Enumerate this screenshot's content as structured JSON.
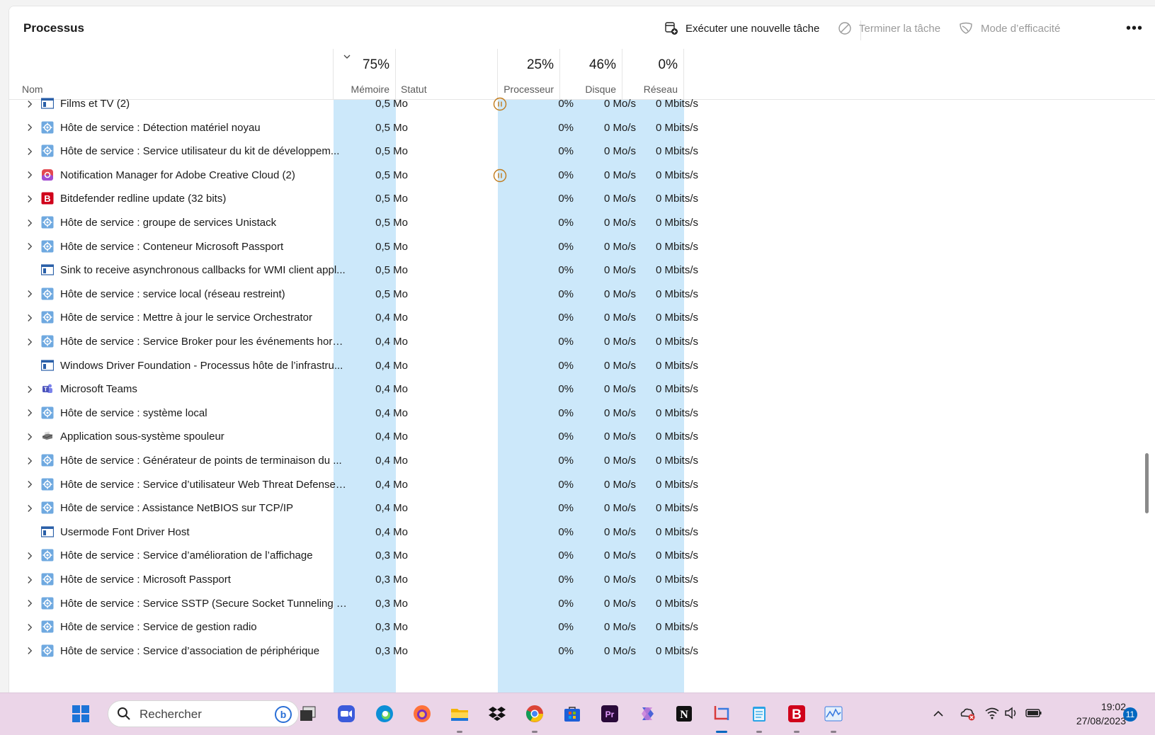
{
  "page": {
    "title": "Processus"
  },
  "toolbar": {
    "new_task": "Exécuter une nouvelle tâche",
    "end_task": "Terminer la tâche",
    "efficiency": "Mode d’efficacité",
    "more": "•••"
  },
  "columns": {
    "name": "Nom",
    "memory": {
      "pct": "75%",
      "label": "Mémoire"
    },
    "status": "Statut",
    "cpu": {
      "pct": "25%",
      "label": "Processeur"
    },
    "disk": {
      "pct": "46%",
      "label": "Disque"
    },
    "network": {
      "pct": "0%",
      "label": "Réseau"
    }
  },
  "rows": [
    {
      "name": "Films et TV (2)",
      "icon": "app-window-icon",
      "expand": true,
      "mem": "0,5 Mo",
      "status": "paused",
      "cpu": "0%",
      "disk": "0 Mo/s",
      "net": "0 Mbits/s"
    },
    {
      "name": "Hôte de service : Détection matériel noyau",
      "icon": "gear-icon",
      "expand": true,
      "mem": "0,5 Mo",
      "status": "",
      "cpu": "0%",
      "disk": "0 Mo/s",
      "net": "0 Mbits/s"
    },
    {
      "name": "Hôte de service : Service utilisateur du kit de développem...",
      "icon": "gear-icon",
      "expand": true,
      "mem": "0,5 Mo",
      "status": "",
      "cpu": "0%",
      "disk": "0 Mo/s",
      "net": "0 Mbits/s"
    },
    {
      "name": "Notification Manager for Adobe Creative Cloud (2)",
      "icon": "adobe-cc-icon",
      "expand": true,
      "mem": "0,5 Mo",
      "status": "paused",
      "cpu": "0%",
      "disk": "0 Mo/s",
      "net": "0 Mbits/s"
    },
    {
      "name": "Bitdefender redline update (32 bits)",
      "icon": "bitdefender-icon",
      "expand": true,
      "mem": "0,5 Mo",
      "status": "",
      "cpu": "0%",
      "disk": "0 Mo/s",
      "net": "0 Mbits/s"
    },
    {
      "name": "Hôte de service : groupe de services Unistack",
      "icon": "gear-icon",
      "expand": true,
      "mem": "0,5 Mo",
      "status": "",
      "cpu": "0%",
      "disk": "0 Mo/s",
      "net": "0 Mbits/s"
    },
    {
      "name": "Hôte de service : Conteneur Microsoft Passport",
      "icon": "gear-icon",
      "expand": true,
      "mem": "0,5 Mo",
      "status": "",
      "cpu": "0%",
      "disk": "0 Mo/s",
      "net": "0 Mbits/s"
    },
    {
      "name": "Sink to receive asynchronous callbacks for WMI client appl...",
      "icon": "app-window-icon",
      "expand": false,
      "mem": "0,5 Mo",
      "status": "",
      "cpu": "0%",
      "disk": "0 Mo/s",
      "net": "0 Mbits/s"
    },
    {
      "name": "Hôte de service : service local (réseau restreint)",
      "icon": "gear-icon",
      "expand": true,
      "mem": "0,5 Mo",
      "status": "",
      "cpu": "0%",
      "disk": "0 Mo/s",
      "net": "0 Mbits/s"
    },
    {
      "name": "Hôte de service : Mettre à jour le service Orchestrator",
      "icon": "gear-icon",
      "expand": true,
      "mem": "0,4 Mo",
      "status": "",
      "cpu": "0%",
      "disk": "0 Mo/s",
      "net": "0 Mbits/s"
    },
    {
      "name": "Hôte de service : Service Broker pour les événements horai...",
      "icon": "gear-icon",
      "expand": true,
      "mem": "0,4 Mo",
      "status": "",
      "cpu": "0%",
      "disk": "0 Mo/s",
      "net": "0 Mbits/s"
    },
    {
      "name": "Windows Driver Foundation - Processus hôte de l’infrastru...",
      "icon": "app-window-icon",
      "expand": false,
      "mem": "0,4 Mo",
      "status": "",
      "cpu": "0%",
      "disk": "0 Mo/s",
      "net": "0 Mbits/s"
    },
    {
      "name": "Microsoft Teams",
      "icon": "teams-icon",
      "expand": true,
      "mem": "0,4 Mo",
      "status": "",
      "cpu": "0%",
      "disk": "0 Mo/s",
      "net": "0 Mbits/s"
    },
    {
      "name": "Hôte de service : système local",
      "icon": "gear-icon",
      "expand": true,
      "mem": "0,4 Mo",
      "status": "",
      "cpu": "0%",
      "disk": "0 Mo/s",
      "net": "0 Mbits/s"
    },
    {
      "name": "Application sous-système spouleur",
      "icon": "printer-icon",
      "expand": true,
      "mem": "0,4 Mo",
      "status": "",
      "cpu": "0%",
      "disk": "0 Mo/s",
      "net": "0 Mbits/s"
    },
    {
      "name": "Hôte de service : Générateur de points de terminaison du ...",
      "icon": "gear-icon",
      "expand": true,
      "mem": "0,4 Mo",
      "status": "",
      "cpu": "0%",
      "disk": "0 Mo/s",
      "net": "0 Mbits/s"
    },
    {
      "name": "Hôte de service : Service d’utilisateur Web Threat Defense_...",
      "icon": "gear-icon",
      "expand": true,
      "mem": "0,4 Mo",
      "status": "",
      "cpu": "0%",
      "disk": "0 Mo/s",
      "net": "0 Mbits/s"
    },
    {
      "name": "Hôte de service : Assistance NetBIOS sur TCP/IP",
      "icon": "gear-icon",
      "expand": true,
      "mem": "0,4 Mo",
      "status": "",
      "cpu": "0%",
      "disk": "0 Mo/s",
      "net": "0 Mbits/s"
    },
    {
      "name": "Usermode Font Driver Host",
      "icon": "app-window-icon",
      "expand": false,
      "mem": "0,4 Mo",
      "status": "",
      "cpu": "0%",
      "disk": "0 Mo/s",
      "net": "0 Mbits/s"
    },
    {
      "name": "Hôte de service : Service d’amélioration de l’affichage",
      "icon": "gear-icon",
      "expand": true,
      "mem": "0,3 Mo",
      "status": "",
      "cpu": "0%",
      "disk": "0 Mo/s",
      "net": "0 Mbits/s"
    },
    {
      "name": "Hôte de service : Microsoft Passport",
      "icon": "gear-icon",
      "expand": true,
      "mem": "0,3 Mo",
      "status": "",
      "cpu": "0%",
      "disk": "0 Mo/s",
      "net": "0 Mbits/s"
    },
    {
      "name": "Hôte de service : Service SSTP (Secure Socket Tunneling Pr...",
      "icon": "gear-icon",
      "expand": true,
      "mem": "0,3 Mo",
      "status": "",
      "cpu": "0%",
      "disk": "0 Mo/s",
      "net": "0 Mbits/s"
    },
    {
      "name": "Hôte de service : Service de gestion radio",
      "icon": "gear-icon",
      "expand": true,
      "mem": "0,3 Mo",
      "status": "",
      "cpu": "0%",
      "disk": "0 Mo/s",
      "net": "0 Mbits/s"
    },
    {
      "name": "Hôte de service : Service d’association de périphérique",
      "icon": "gear-icon",
      "expand": true,
      "mem": "0,3 Mo",
      "status": "",
      "cpu": "0%",
      "disk": "0 Mo/s",
      "net": "0 Mbits/s"
    }
  ],
  "taskbar": {
    "search_placeholder": "Rechercher",
    "apps": [
      "start-icon",
      "task-view-icon",
      "zoom-icon",
      "edge-icon",
      "firefox-icon",
      "file-explorer-icon",
      "dropbox-icon",
      "chrome-icon",
      "ms-store-icon",
      "premiere-icon",
      "copilot-icon",
      "notion-icon",
      "snipping-tool-icon",
      "notepad-icon",
      "bitdefender-icon",
      "task-manager-icon"
    ],
    "time": "19:02",
    "date": "27/08/2023",
    "notification_count": "11"
  },
  "colors": {
    "heat": "#cce8fa",
    "accent": "#0067c0",
    "taskbar": "#ebd5e8",
    "paused": "#c07a1a"
  }
}
